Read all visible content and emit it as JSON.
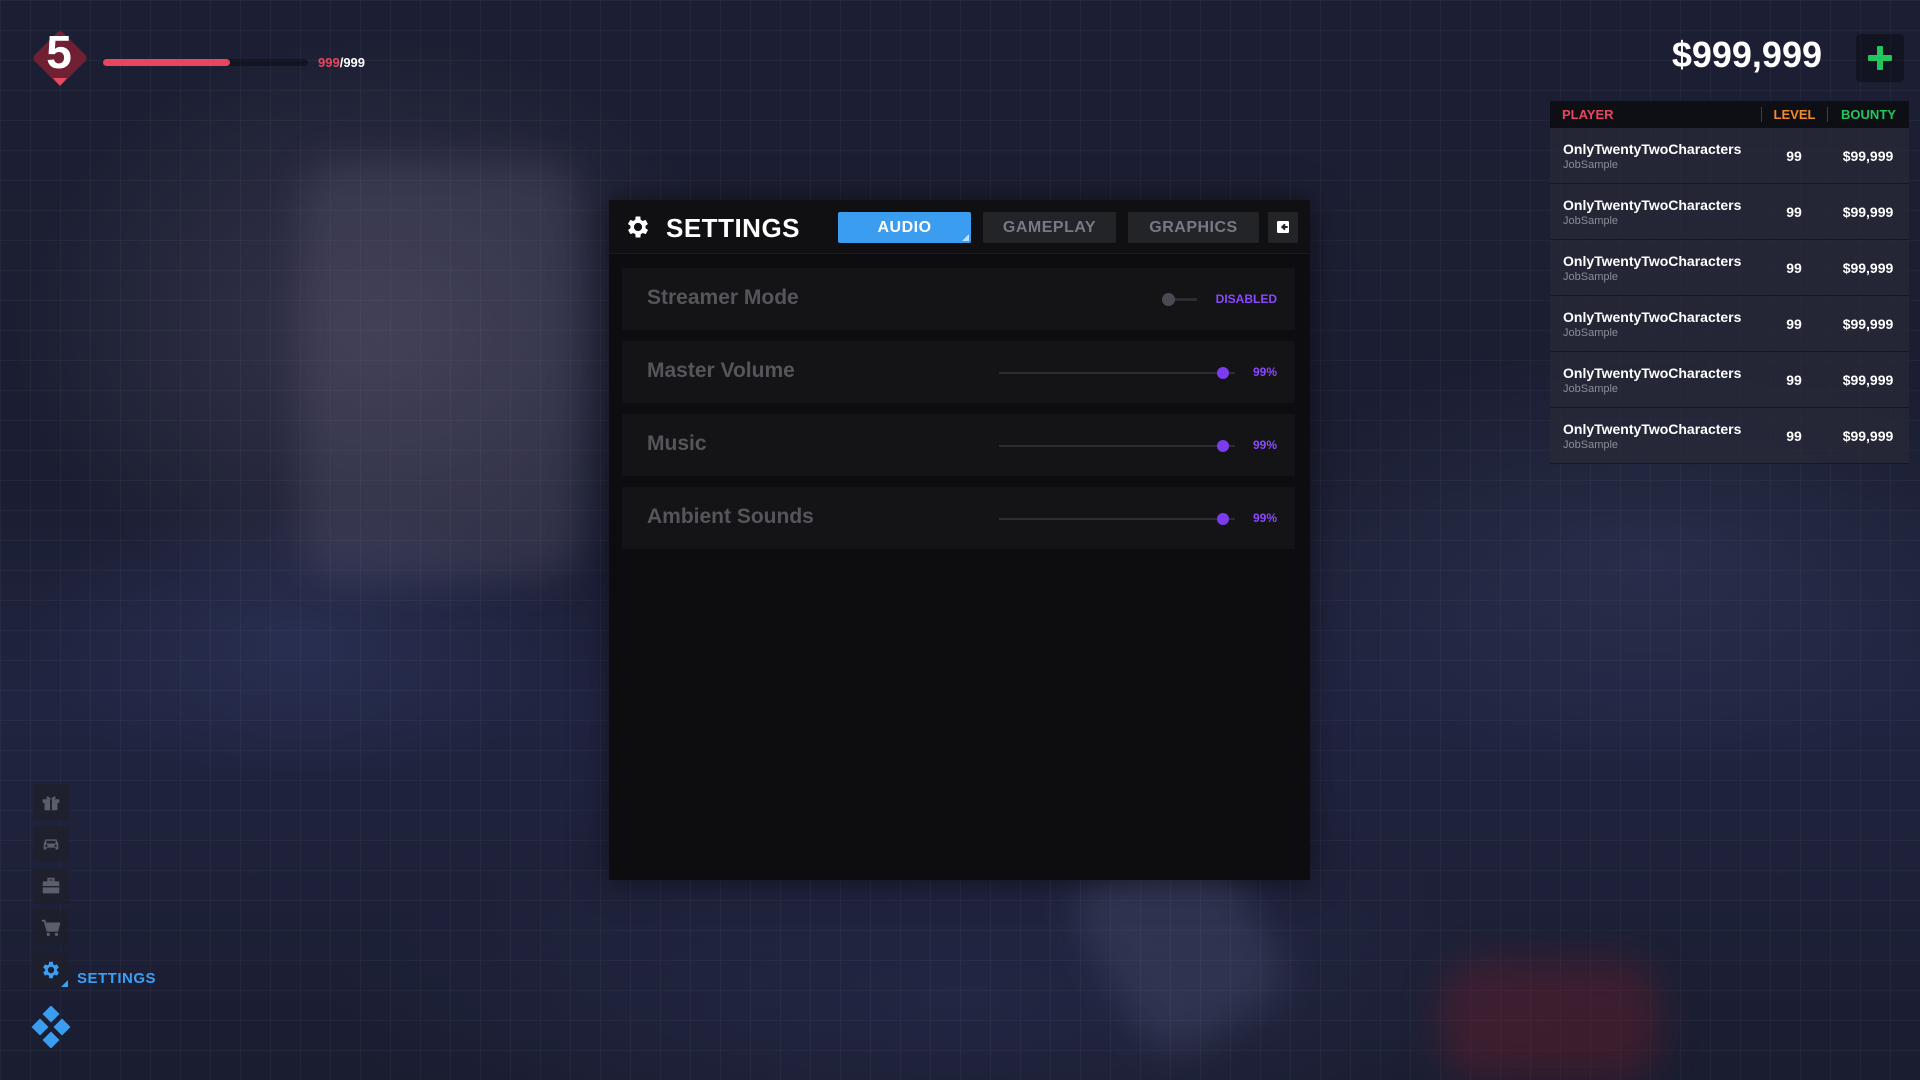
{
  "hud": {
    "level": "5",
    "xp_current": "999",
    "xp_separator": "/",
    "xp_max": "999",
    "xp_fraction": 0.62,
    "money": "$999,999"
  },
  "scoreboard": {
    "headers": {
      "player": "PLAYER",
      "level": "LEVEL",
      "bounty": "BOUNTY"
    },
    "rows": [
      {
        "name": "OnlyTwentyTwoCharacters",
        "job": "JobSample",
        "level": "99",
        "bounty": "$99,999"
      },
      {
        "name": "OnlyTwentyTwoCharacters",
        "job": "JobSample",
        "level": "99",
        "bounty": "$99,999"
      },
      {
        "name": "OnlyTwentyTwoCharacters",
        "job": "JobSample",
        "level": "99",
        "bounty": "$99,999"
      },
      {
        "name": "OnlyTwentyTwoCharacters",
        "job": "JobSample",
        "level": "99",
        "bounty": "$99,999"
      },
      {
        "name": "OnlyTwentyTwoCharacters",
        "job": "JobSample",
        "level": "99",
        "bounty": "$99,999"
      },
      {
        "name": "OnlyTwentyTwoCharacters",
        "job": "JobSample",
        "level": "99",
        "bounty": "$99,999"
      }
    ]
  },
  "settings": {
    "title": "SETTINGS",
    "tabs": [
      {
        "label": "AUDIO",
        "active": true
      },
      {
        "label": "GAMEPLAY",
        "active": false
      },
      {
        "label": "GRAPHICS",
        "active": false
      }
    ],
    "streamer_mode": {
      "label": "Streamer Mode",
      "state": "DISABLED"
    },
    "sliders": [
      {
        "label": "Master Volume",
        "value": "99%",
        "level": 0.99
      },
      {
        "label": "Music",
        "value": "99%",
        "level": 0.99
      },
      {
        "label": "Ambient Sounds",
        "value": "99%",
        "level": 0.99
      }
    ]
  },
  "dock": {
    "items": [
      "gift-icon",
      "car-icon",
      "briefcase-icon",
      "cart-icon",
      "gear-icon"
    ],
    "active_label": "SETTINGS"
  },
  "colors": {
    "accent_blue": "#3a9df0",
    "accent_purple": "#8a48ff",
    "health_red": "#e8465f",
    "money_green": "#22c55e",
    "level_orange": "#f08a2c"
  }
}
